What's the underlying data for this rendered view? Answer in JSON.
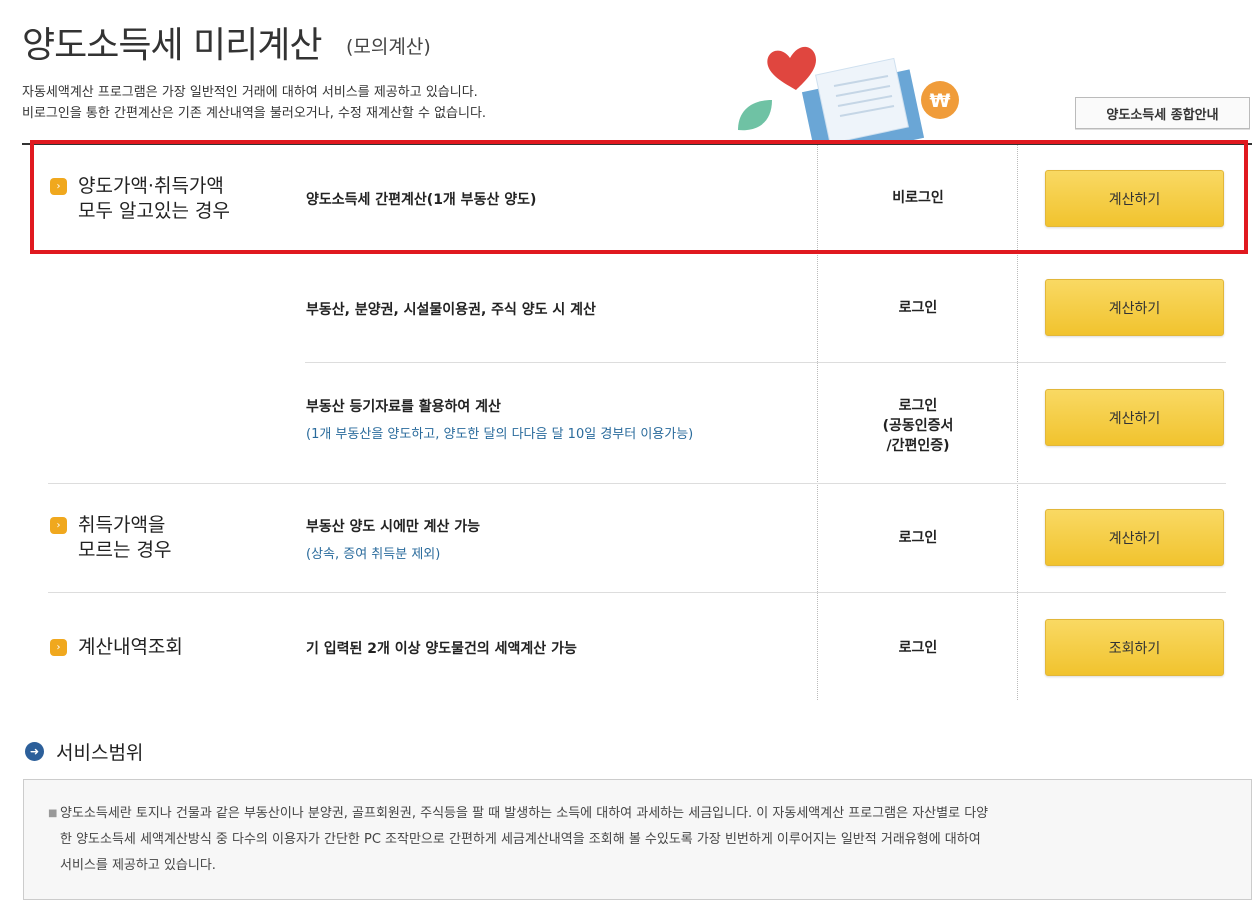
{
  "header": {
    "title": "양도소득세 미리계산",
    "subtitle": "(모의계산)",
    "desc_line1": "자동세액계산 프로그램은 가장 일반적인 거래에 대하여 서비스를 제공하고 있습니다.",
    "desc_line2": "비로그인을 통한 간편계산은 기존 계산내역을 불러오거나, 수정 재계산할 수 없습니다.",
    "guide_button": "양도소득세 종합안내"
  },
  "rows": [
    {
      "label_line1": "양도가액·취득가액",
      "label_line2": "모두 알고있는 경우",
      "service": "양도소득세 간편계산(1개 부동산 양도)",
      "login": "비로그인",
      "button": "계산하기"
    },
    {
      "service": "부동산, 분양권, 시설물이용권, 주식 양도 시 계산",
      "login": "로그인",
      "button": "계산하기"
    },
    {
      "service": "부동산 등기자료를 활용하여 계산",
      "note": "(1개 부동산을 양도하고, 양도한 달의 다다음 달 10일 경부터 이용가능)",
      "login_line1": "로그인",
      "login_line2": "(공동인증서",
      "login_line3": "/간편인증)",
      "button": "계산하기"
    },
    {
      "label_line1": "취득가액을",
      "label_line2": "모르는 경우",
      "service": "부동산 양도 시에만 계산 가능",
      "note": "(상속, 증여 취득분 제외)",
      "login": "로그인",
      "button": "계산하기"
    },
    {
      "label_line1": "계산내역조회",
      "service": "기 입력된 2개 이상 양도물건의 세액계산 가능",
      "login": "로그인",
      "button": "조회하기"
    }
  ],
  "scope": {
    "title": "서비스범위",
    "line1": "양도소득세란 토지나 건물과 같은 부동산이나 분양권, 골프회원권, 주식등을 팔 때 발생하는 소득에 대하여 과세하는 세금입니다. 이 자동세액계산 프로그램은 자산별로 다양",
    "line2": "한 양도소득세 세액계산방식 중 다수의 이용자가 간단한 PC 조작만으로 간편하게 세금계산내역을 조회해 볼 수있도록 가장 빈번하게 이루어지는 일반적 거래유형에 대하여",
    "line3": "서비스를 제공하고 있습니다."
  },
  "colors": {
    "highlight": "#e0191f",
    "button": "#f4c93a",
    "bullet": "#f0a81e",
    "note": "#2a6b9c",
    "arrow": "#2c5f9a"
  },
  "icons": [
    "heart-icon",
    "document-icon",
    "won-coin-icon",
    "leaf-icon",
    "bullet-icon",
    "arrow-right-icon"
  ]
}
